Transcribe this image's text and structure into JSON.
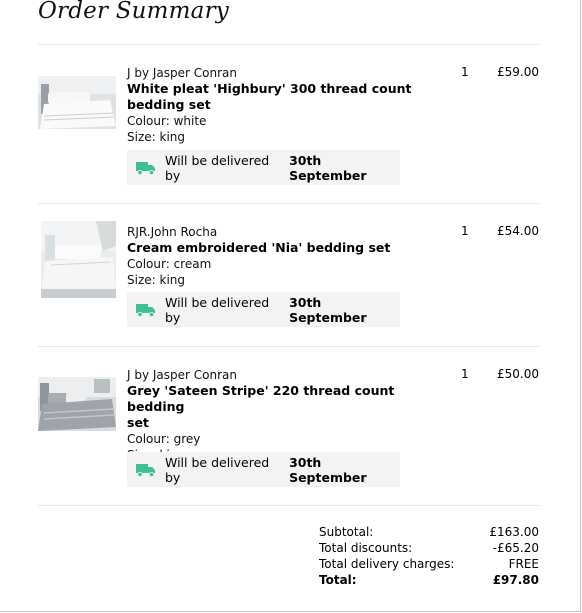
{
  "header": {
    "title": "Order Summary"
  },
  "items": [
    {
      "brand": "J by Jasper Conran",
      "name_line1": "White pleat 'Highbury' 300 thread count",
      "name_line2": "bedding set",
      "colour": "Colour: white",
      "size": "Size: king",
      "qty": "1",
      "price": "£59.00",
      "delivery_prefix": "Will be delivered by",
      "delivery_date": "30th  September",
      "thumb_icon": "white-bedding-thumbnail"
    },
    {
      "brand": "RJR.John Rocha",
      "name_line1": "Cream embroidered 'Nia' bedding set",
      "colour": "Colour: cream",
      "size": "Size: king",
      "qty": "1",
      "price": "£54.00",
      "delivery_prefix": "Will be delivered by",
      "delivery_date": "30th  September",
      "thumb_icon": "cream-bedding-thumbnail"
    },
    {
      "brand": "J by Jasper Conran",
      "name_line1": "Grey 'Sateen Stripe' 220 thread count bedding",
      "name_line2": "set",
      "colour": "Colour: grey",
      "size": "Size: king",
      "qty": "1",
      "price": "£50.00",
      "delivery_prefix": "Will be delivered by",
      "delivery_date": "30th  September",
      "thumb_icon": "grey-bedding-thumbnail"
    }
  ],
  "summary": {
    "subtotal_label": "Subtotal:",
    "subtotal_value": "£163.00",
    "discounts_label": "Total discounts:",
    "discounts_value": "-£65.20",
    "delivery_label": "Total delivery charges:",
    "delivery_value": "FREE",
    "total_label": "Total:",
    "total_value": "£97.80"
  },
  "colors": {
    "truck": "#3dbf8f",
    "delivery_bg": "#f3f3f3",
    "divider": "#e6e6e6"
  },
  "icons": {
    "delivery": "truck-icon"
  }
}
